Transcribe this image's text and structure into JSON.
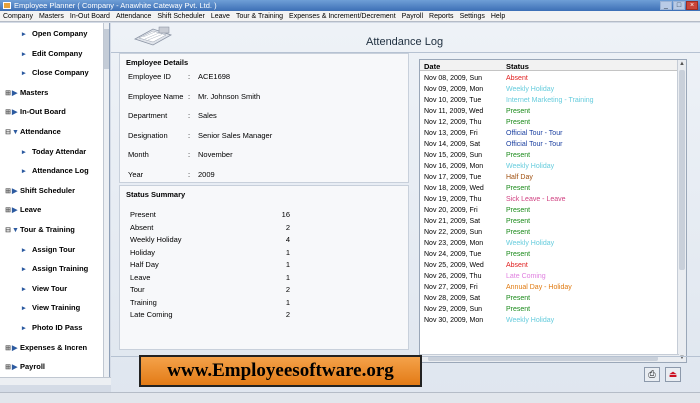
{
  "window": {
    "title": "Employee Planner ( Company - Anawhite Cateway Pvt. Ltd. )"
  },
  "menu": [
    "Company",
    "Masters",
    "In-Out Board",
    "Attendance",
    "Shift Scheduler",
    "Leave",
    "Tour & Training",
    "Expenses & Increment/Decrement",
    "Payroll",
    "Reports",
    "Settings",
    "Help"
  ],
  "sidebar": {
    "items": [
      {
        "label": "Open Company",
        "level": "sub"
      },
      {
        "label": "Edit Company",
        "level": "sub"
      },
      {
        "label": "Close Company",
        "level": "sub"
      },
      {
        "label": "Masters",
        "level": "top",
        "expanded": false
      },
      {
        "label": "In-Out Board",
        "level": "top",
        "expanded": false
      },
      {
        "label": "Attendance",
        "level": "top",
        "expanded": true
      },
      {
        "label": "Today Attendar",
        "level": "sub"
      },
      {
        "label": "Attendance Log",
        "level": "sub"
      },
      {
        "label": "Shift Scheduler",
        "level": "top",
        "expanded": false
      },
      {
        "label": "Leave",
        "level": "top",
        "expanded": false
      },
      {
        "label": "Tour & Training",
        "level": "top",
        "expanded": true
      },
      {
        "label": "Assign Tour",
        "level": "sub"
      },
      {
        "label": "Assign Training",
        "level": "sub"
      },
      {
        "label": "View Tour",
        "level": "sub"
      },
      {
        "label": "View Training",
        "level": "sub"
      },
      {
        "label": "Photo ID Pass",
        "level": "sub"
      },
      {
        "label": "Expenses & Incren",
        "level": "top",
        "expanded": false
      },
      {
        "label": "Payroll",
        "level": "top",
        "expanded": false
      }
    ]
  },
  "page": {
    "title": "Attendance Log"
  },
  "employee": {
    "heading": "Employee Details",
    "fields": [
      {
        "label": "Employee ID",
        "value": "ACE1698"
      },
      {
        "label": "Employee Name",
        "value": "Mr. Johnson Smith"
      },
      {
        "label": "Department",
        "value": "Sales"
      },
      {
        "label": "Designation",
        "value": "Senior Sales Manager"
      },
      {
        "label": "Month",
        "value": "November"
      },
      {
        "label": "Year",
        "value": "2009"
      }
    ]
  },
  "summary": {
    "heading": "Status Summary",
    "rows": [
      {
        "label": "Present",
        "count": "16"
      },
      {
        "label": "Absent",
        "count": "2"
      },
      {
        "label": "Weekly Holiday",
        "count": "4"
      },
      {
        "label": "Holiday",
        "count": "1"
      },
      {
        "label": "Half Day",
        "count": "1"
      },
      {
        "label": "Leave",
        "count": "1"
      },
      {
        "label": "Tour",
        "count": "2"
      },
      {
        "label": "Training",
        "count": "1"
      },
      {
        "label": "Late Coming",
        "count": "2"
      }
    ]
  },
  "log": {
    "columns": [
      "Date",
      "Status"
    ],
    "rows": [
      {
        "date": "Nov 08, 2009,  Sun",
        "status": "Absent",
        "color": "#e02020"
      },
      {
        "date": "Nov 09, 2009,  Mon",
        "status": "Weekly Holiday",
        "color": "#66ccdd"
      },
      {
        "date": "Nov 10, 2009,  Tue",
        "status": "Internet Marketing - Training",
        "color": "#66ccdd"
      },
      {
        "date": "Nov 11, 2009,  Wed",
        "status": "Present",
        "color": "#1a8a1a"
      },
      {
        "date": "Nov 12, 2009,  Thu",
        "status": "Present",
        "color": "#1a8a1a"
      },
      {
        "date": "Nov 13, 2009,  Fri",
        "status": "Official Tour - Tour",
        "color": "#1a3fa0"
      },
      {
        "date": "Nov 14, 2009,  Sat",
        "status": "Official Tour - Tour",
        "color": "#1a3fa0"
      },
      {
        "date": "Nov 15, 2009,  Sun",
        "status": "Present",
        "color": "#1a8a1a"
      },
      {
        "date": "Nov 16, 2009,  Mon",
        "status": "Weekly Holiday",
        "color": "#66ccdd"
      },
      {
        "date": "Nov 17, 2009,  Tue",
        "status": "Half Day",
        "color": "#a05010"
      },
      {
        "date": "Nov 18, 2009,  Wed",
        "status": "Present",
        "color": "#1a8a1a"
      },
      {
        "date": "Nov 19, 2009,  Thu",
        "status": "Sick Leave - Leave",
        "color": "#d04080"
      },
      {
        "date": "Nov 20, 2009,  Fri",
        "status": "Present",
        "color": "#1a8a1a"
      },
      {
        "date": "Nov 21, 2009,  Sat",
        "status": "Present",
        "color": "#1a8a1a"
      },
      {
        "date": "Nov 22, 2009,  Sun",
        "status": "Present",
        "color": "#1a8a1a"
      },
      {
        "date": "Nov 23, 2009,  Mon",
        "status": "Weekly Holiday",
        "color": "#66ccdd"
      },
      {
        "date": "Nov 24, 2009,  Tue",
        "status": "Present",
        "color": "#1a8a1a"
      },
      {
        "date": "Nov 25, 2009,  Wed",
        "status": "Absent",
        "color": "#e02020"
      },
      {
        "date": "Nov 26, 2009,  Thu",
        "status": "Late Coming",
        "color": "#e080e0"
      },
      {
        "date": "Nov 27, 2009,  Fri",
        "status": "Annual Day - Holiday",
        "color": "#e07a10"
      },
      {
        "date": "Nov 28, 2009,  Sat",
        "status": "Present",
        "color": "#1a8a1a"
      },
      {
        "date": "Nov 29, 2009,  Sun",
        "status": "Present",
        "color": "#1a8a1a"
      },
      {
        "date": "Nov 30, 2009,  Mon",
        "status": "Weekly Holiday",
        "color": "#66ccdd"
      }
    ]
  },
  "banner": {
    "text": "www.Employeesoftware.org"
  },
  "icons": {
    "print": "printer-icon",
    "exit": "exit-icon"
  }
}
